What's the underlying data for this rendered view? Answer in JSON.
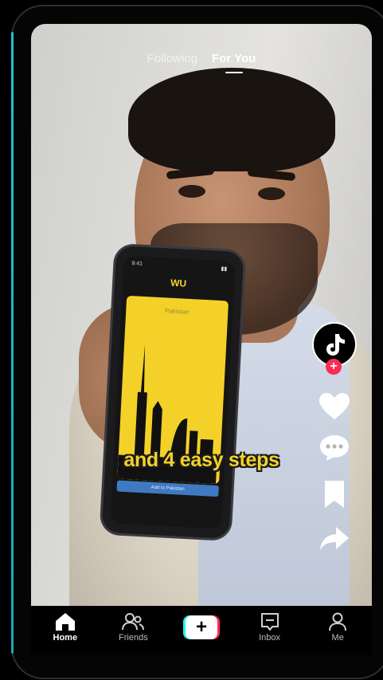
{
  "top_tabs": {
    "following": "Following",
    "for_you": "For You",
    "active": "For You"
  },
  "video": {
    "caption": "and 4 easy steps",
    "held_phone": {
      "logo": "WU",
      "header": "Pakistan",
      "bar_text": "Add to Pakistan"
    }
  },
  "right_rail": {
    "avatar_icon": "tiktok-logo-icon",
    "follow_icon": "plus-icon",
    "actions": [
      "heart-icon",
      "comment-icon",
      "bookmark-icon",
      "share-icon"
    ]
  },
  "bottom_nav": {
    "items": [
      {
        "label": "Home",
        "icon": "home-icon",
        "active": true
      },
      {
        "label": "Friends",
        "icon": "friends-icon",
        "active": false
      },
      {
        "label": "",
        "icon": "create-plus-icon",
        "active": false
      },
      {
        "label": "Inbox",
        "icon": "inbox-icon",
        "active": false
      },
      {
        "label": "Me",
        "icon": "profile-icon",
        "active": false
      }
    ]
  },
  "colors": {
    "accent_red": "#fe2c55",
    "accent_cyan": "#25f4ee",
    "caption_yellow": "#f2d22a"
  }
}
